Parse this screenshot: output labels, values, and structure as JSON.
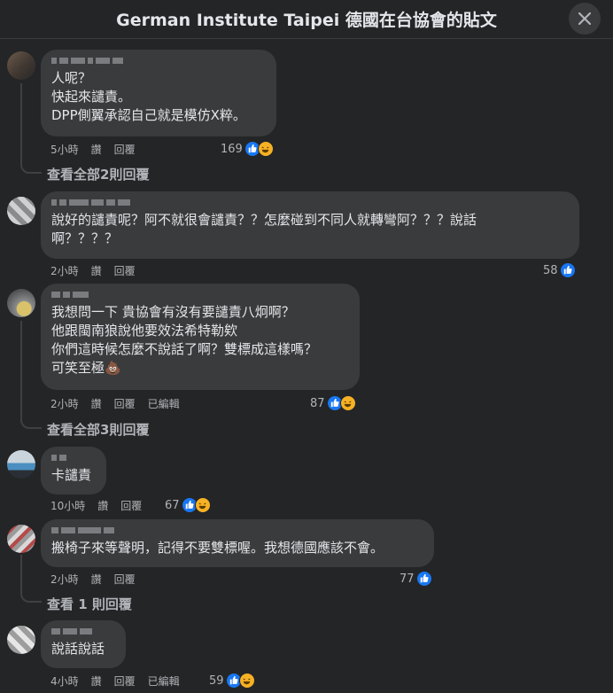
{
  "header": {
    "title": "German Institute Taipei 德國在台協會的貼文"
  },
  "comments": [
    {
      "text": "人呢？\n快起來譴責。\nDPP側翼承認自己就是模仿X粹。",
      "time": "5小時",
      "like": "讚",
      "reply": "回覆",
      "edited": "",
      "count": "169",
      "reactions": [
        "like",
        "haha"
      ],
      "view_replies": "查看全部2則回覆"
    },
    {
      "text": "說好的譴責呢？阿不就很會譴責？？怎麼碰到不同人就轉彎阿？？？說話\n啊？？？？",
      "time": "2小時",
      "like": "讚",
      "reply": "回覆",
      "edited": "",
      "count": "58",
      "reactions": [
        "like"
      ],
      "view_replies": ""
    },
    {
      "text": "我想問一下 貴協會有沒有要譴責八炯啊？\n他跟閩南狼說他要效法希特勒欸\n你們這時候怎麼不說話了啊？雙標成這樣嗎？\n可笑至極💩",
      "time": "2小時",
      "like": "讚",
      "reply": "回覆",
      "edited": "已編輯",
      "count": "87",
      "reactions": [
        "like",
        "haha"
      ],
      "view_replies": "查看全部3則回覆"
    },
    {
      "text": "卡譴責",
      "time": "10小時",
      "like": "讚",
      "reply": "回覆",
      "edited": "",
      "count": "67",
      "reactions": [
        "like",
        "haha"
      ],
      "view_replies": ""
    },
    {
      "text": "搬椅子來等聲明，記得不要雙標喔。我想德國應該不會。",
      "time": "2小時",
      "like": "讚",
      "reply": "回覆",
      "edited": "",
      "count": "77",
      "reactions": [
        "like"
      ],
      "view_replies": "查看 1 則回覆"
    },
    {
      "text": "說話說話",
      "time": "4小時",
      "like": "讚",
      "reply": "回覆",
      "edited": "已編輯",
      "count": "59",
      "reactions": [
        "like",
        "haha"
      ],
      "view_replies": ""
    }
  ],
  "colors": {
    "background": "#242526",
    "bubble": "#3a3b3c",
    "like": "#1877f2",
    "haha": "#f7b125"
  },
  "icons": [
    "close-icon",
    "like-icon",
    "haha-icon"
  ]
}
